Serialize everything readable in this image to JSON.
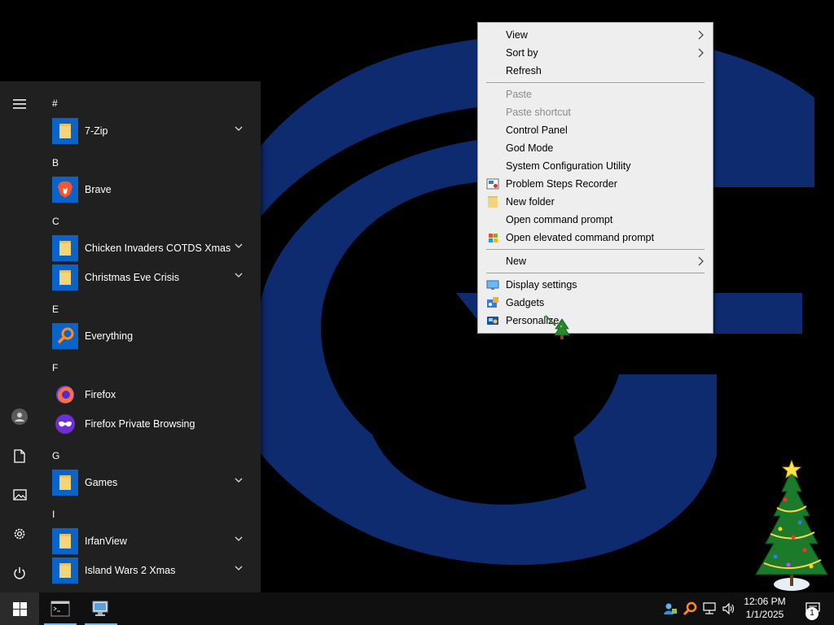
{
  "start_menu": {
    "groups": [
      {
        "letter": "#",
        "apps": [
          {
            "label": "7-Zip",
            "icon": "folder-icon",
            "expandable": true
          }
        ]
      },
      {
        "letter": "B",
        "apps": [
          {
            "label": "Brave",
            "icon": "brave-icon",
            "expandable": false
          }
        ]
      },
      {
        "letter": "C",
        "apps": [
          {
            "label": "Chicken Invaders COTDS Xmas",
            "icon": "folder-icon",
            "expandable": true
          },
          {
            "label": "Christmas Eve Crisis",
            "icon": "folder-icon",
            "expandable": true
          }
        ]
      },
      {
        "letter": "E",
        "apps": [
          {
            "label": "Everything",
            "icon": "everything-search-icon",
            "expandable": false
          }
        ]
      },
      {
        "letter": "F",
        "apps": [
          {
            "label": "Firefox",
            "icon": "firefox-icon",
            "expandable": false
          },
          {
            "label": "Firefox Private Browsing",
            "icon": "firefox-private-icon",
            "expandable": false
          }
        ]
      },
      {
        "letter": "G",
        "apps": [
          {
            "label": "Games",
            "icon": "folder-icon",
            "expandable": true
          }
        ]
      },
      {
        "letter": "I",
        "apps": [
          {
            "label": "IrfanView",
            "icon": "folder-icon",
            "expandable": true
          },
          {
            "label": "Island Wars 2 Xmas",
            "icon": "folder-icon",
            "expandable": true
          }
        ]
      }
    ],
    "rail_icons": [
      "hamburger-menu-icon",
      "user-account-icon",
      "documents-icon",
      "pictures-icon",
      "settings-gear-icon",
      "power-icon"
    ]
  },
  "context_menu": {
    "items": [
      {
        "label": "View",
        "submenu": true,
        "disabled": false,
        "icon": null
      },
      {
        "label": "Sort by",
        "submenu": true,
        "disabled": false,
        "icon": null
      },
      {
        "label": "Refresh",
        "submenu": false,
        "disabled": false,
        "icon": null
      },
      {
        "separator": true
      },
      {
        "label": "Paste",
        "submenu": false,
        "disabled": true,
        "icon": null
      },
      {
        "label": "Paste shortcut",
        "submenu": false,
        "disabled": true,
        "icon": null
      },
      {
        "label": "Control Panel",
        "submenu": false,
        "disabled": false,
        "icon": null
      },
      {
        "label": "God Mode",
        "submenu": false,
        "disabled": false,
        "icon": null
      },
      {
        "label": "System Configuration Utility",
        "submenu": false,
        "disabled": false,
        "icon": null
      },
      {
        "label": "Problem Steps Recorder",
        "submenu": false,
        "disabled": false,
        "icon": "steps-recorder-icon"
      },
      {
        "label": "New folder",
        "submenu": false,
        "disabled": false,
        "icon": "folder-icon"
      },
      {
        "label": "Open command prompt",
        "submenu": false,
        "disabled": false,
        "icon": null
      },
      {
        "label": "Open elevated command prompt",
        "submenu": false,
        "disabled": false,
        "icon": "windows-shield-icon"
      },
      {
        "separator": true
      },
      {
        "label": "New",
        "submenu": true,
        "disabled": false,
        "icon": null
      },
      {
        "separator": true
      },
      {
        "label": "Display settings",
        "submenu": false,
        "disabled": false,
        "icon": "display-icon"
      },
      {
        "label": "Gadgets",
        "submenu": false,
        "disabled": false,
        "icon": "gadgets-icon"
      },
      {
        "label": "Personalize",
        "submenu": false,
        "disabled": false,
        "icon": "personalize-icon"
      }
    ]
  },
  "taskbar": {
    "apps": [
      {
        "name": "command-prompt-icon",
        "active": true
      },
      {
        "name": "remote-desktop-icon",
        "active": true
      }
    ],
    "tray_icons": [
      "network-user-icon",
      "everything-search-icon",
      "network-icon",
      "volume-icon"
    ],
    "clock": {
      "time": "12:06 PM",
      "date": "1/1/2025"
    },
    "notification_count": "1"
  },
  "colors": {
    "wallpaper_blue": "#0d2b6e",
    "start_bg": "#202020",
    "tile_blue": "#0a64c8",
    "folder_yellow": "#f6d47a"
  }
}
